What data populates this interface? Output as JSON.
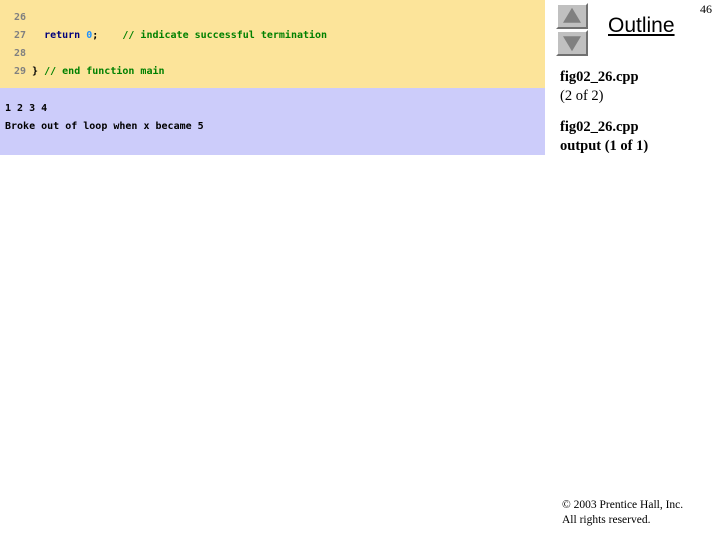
{
  "slide": {
    "page_number": "46",
    "colors": {
      "code_background": "#fce49a",
      "output_background": "#ccccfa",
      "line_number": "#808080",
      "keyword": "#00007b",
      "number_literal": "#1e90ff",
      "comment": "#008000",
      "button_face": "#c0c0c0",
      "triangle": "#808080"
    }
  },
  "code_block": {
    "lines": [
      {
        "number": "26",
        "tokens": [
          {
            "text": "",
            "type": "plain"
          }
        ]
      },
      {
        "number": "27",
        "tokens": [
          {
            "text": "   ",
            "type": "plain"
          },
          {
            "text": "return",
            "type": "keyword"
          },
          {
            "text": " ",
            "type": "plain"
          },
          {
            "text": "0",
            "type": "number"
          },
          {
            "text": ";",
            "type": "punct"
          },
          {
            "text": "    ",
            "type": "plain"
          },
          {
            "text": "// indicate successful termination",
            "type": "comment"
          }
        ]
      },
      {
        "number": "28",
        "tokens": [
          {
            "text": "",
            "type": "plain"
          }
        ]
      },
      {
        "number": "29",
        "tokens": [
          {
            "text": " ",
            "type": "plain"
          },
          {
            "text": "}",
            "type": "punct"
          },
          {
            "text": " ",
            "type": "plain"
          },
          {
            "text": "// end function main",
            "type": "comment"
          }
        ]
      }
    ]
  },
  "output_block": {
    "lines": [
      "1 2 3 4",
      "Broke out of loop when x became 5"
    ]
  },
  "outline_panel": {
    "title": "Outline",
    "nav": {
      "up_label": "up-arrow",
      "down_label": "down-arrow"
    },
    "items": [
      {
        "lines": [
          {
            "text": "fig02_26.cpp",
            "bold": true
          },
          {
            "text": "(2 of 2)",
            "bold": false
          }
        ]
      },
      {
        "lines": [
          {
            "text": "fig02_26.cpp",
            "bold": true
          },
          {
            "text": "output (1 of 1)",
            "bold": true
          }
        ]
      }
    ]
  },
  "footer": {
    "line1": "© 2003 Prentice Hall, Inc.",
    "line2": "All rights reserved."
  }
}
